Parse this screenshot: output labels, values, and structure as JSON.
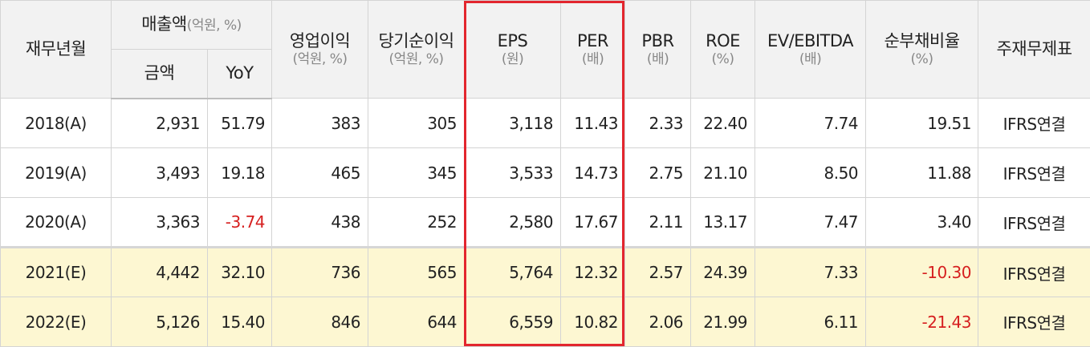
{
  "header": {
    "period": "재무년월",
    "revenue": {
      "label": "매출액",
      "unit": "(억원, %)",
      "amount": "금액",
      "yoy": "YoY"
    },
    "operating_profit": {
      "label": "영업이익",
      "unit": "(억원, %)"
    },
    "net_income": {
      "label": "당기순이익",
      "unit": "(억원, %)"
    },
    "eps": {
      "label": "EPS",
      "unit": "(원)"
    },
    "per": {
      "label": "PER",
      "unit": "(배)"
    },
    "pbr": {
      "label": "PBR",
      "unit": "(배)"
    },
    "roe": {
      "label": "ROE",
      "unit": "(%)"
    },
    "ev_ebitda": {
      "label": "EV/EBITDA",
      "unit": "(배)"
    },
    "net_debt_ratio": {
      "label": "순부채비율",
      "unit": "(%)"
    },
    "main_statement": "주재무제표"
  },
  "rows": [
    {
      "period": "2018(A)",
      "revenue": "2,931",
      "yoy": "51.79",
      "op": "383",
      "ni": "305",
      "eps": "3,118",
      "per": "11.43",
      "pbr": "2.33",
      "roe": "22.40",
      "ev": "7.74",
      "debt": "19.51",
      "note": "IFRS연결"
    },
    {
      "period": "2019(A)",
      "revenue": "3,493",
      "yoy": "19.18",
      "op": "465",
      "ni": "345",
      "eps": "3,533",
      "per": "14.73",
      "pbr": "2.75",
      "roe": "21.10",
      "ev": "8.50",
      "debt": "11.88",
      "note": "IFRS연결"
    },
    {
      "period": "2020(A)",
      "revenue": "3,363",
      "yoy": "-3.74",
      "op": "438",
      "ni": "252",
      "eps": "2,580",
      "per": "17.67",
      "pbr": "2.11",
      "roe": "13.17",
      "ev": "7.47",
      "debt": "3.40",
      "note": "IFRS연결"
    },
    {
      "period": "2021(E)",
      "revenue": "4,442",
      "yoy": "32.10",
      "op": "736",
      "ni": "565",
      "eps": "5,764",
      "per": "12.32",
      "pbr": "2.57",
      "roe": "24.39",
      "ev": "7.33",
      "debt": "-10.30",
      "note": "IFRS연결"
    },
    {
      "period": "2022(E)",
      "revenue": "5,126",
      "yoy": "15.40",
      "op": "846",
      "ni": "644",
      "eps": "6,559",
      "per": "10.82",
      "pbr": "2.06",
      "roe": "21.99",
      "ev": "6.11",
      "debt": "-21.43",
      "note": "IFRS연결"
    }
  ],
  "colors": {
    "negative": "#d61f1f",
    "estimate_bg": "#fdf7d2",
    "highlight_border": "#e3262e",
    "header_bg": "#f2f2f2"
  }
}
